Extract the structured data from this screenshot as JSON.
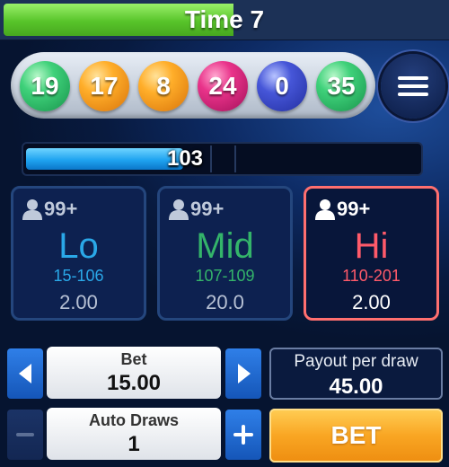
{
  "timer": {
    "label": "Time 7",
    "remaining_fraction": 0.52
  },
  "balls": [
    {
      "number": "19",
      "color": "green"
    },
    {
      "number": "17",
      "color": "orange"
    },
    {
      "number": "8",
      "color": "orange"
    },
    {
      "number": "24",
      "color": "pink"
    },
    {
      "number": "0",
      "color": "blue"
    },
    {
      "number": "35",
      "color": "green"
    }
  ],
  "menu": {
    "icon": "hamburger-menu-icon"
  },
  "progress": {
    "value": "103",
    "fill_fraction": 0.4
  },
  "options": [
    {
      "key": "lo",
      "players": "99+",
      "name": "Lo",
      "range": "15-106",
      "odds": "2.00",
      "color": "#2aa8e8",
      "selected": false
    },
    {
      "key": "mid",
      "players": "99+",
      "name": "Mid",
      "range": "107-109",
      "odds": "20.0",
      "color": "#34b46a",
      "selected": false
    },
    {
      "key": "hi",
      "players": "99+",
      "name": "Hi",
      "range": "110-201",
      "odds": "2.00",
      "color": "#ff5a6a",
      "selected": true
    }
  ],
  "bet": {
    "label": "Bet",
    "value": "15.00"
  },
  "auto_draws": {
    "label": "Auto Draws",
    "value": "1"
  },
  "payout": {
    "label": "Payout per draw",
    "value": "45.00"
  },
  "bet_button": {
    "label": "BET"
  },
  "colors": {
    "accent_blue": "#1f6fd6",
    "bet_orange": "#f9a623",
    "selected_border": "#ff6f6f"
  }
}
